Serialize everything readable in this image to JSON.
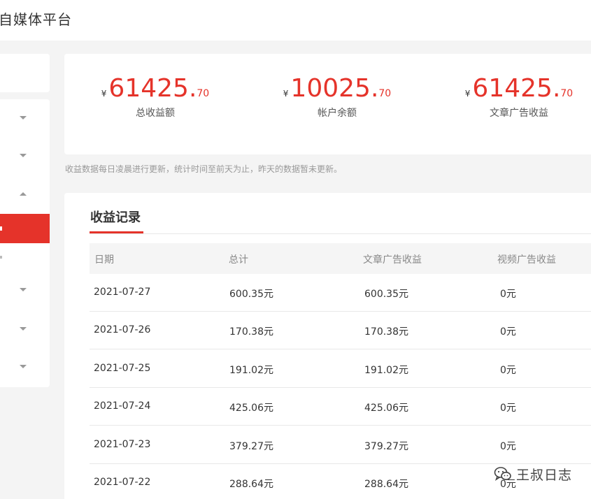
{
  "header": {
    "app_title": "自媒体平台"
  },
  "stats": [
    {
      "currency": "¥",
      "integer": "61425.",
      "decimal": "70",
      "label": "总收益额"
    },
    {
      "currency": "¥",
      "integer": "10025.",
      "decimal": "70",
      "label": "帐户余额"
    },
    {
      "currency": "¥",
      "integer": "61425.",
      "decimal": "70",
      "label": "文章广告收益"
    }
  ],
  "note": "收益数据每日凌晨进行更新，统计时间至前天为止，昨天的数据暂未更新。",
  "records": {
    "title": "收益记录",
    "columns": [
      "日期",
      "总计",
      "文章广告收益",
      "视频广告收益"
    ],
    "rows": [
      [
        "2021-07-27",
        "600.35元",
        "600.35元",
        "0元"
      ],
      [
        "2021-07-26",
        "170.38元",
        "170.38元",
        "0元"
      ],
      [
        "2021-07-25",
        "191.02元",
        "191.02元",
        "0元"
      ],
      [
        "2021-07-24",
        "425.06元",
        "425.06元",
        "0元"
      ],
      [
        "2021-07-23",
        "379.27元",
        "379.27元",
        "0元"
      ],
      [
        "2021-07-22",
        "288.64元",
        "288.64元",
        "0元"
      ]
    ]
  },
  "sidebar": {
    "carets": [
      "chevron-down-icon",
      "chevron-down-icon",
      "chevron-up-icon",
      "chevron-down-icon",
      "chevron-down-icon",
      "chevron-down-icon"
    ]
  },
  "watermark": {
    "text": "王叔日志",
    "logo": "wechat-icon"
  },
  "colors": {
    "accent": "#e5332a",
    "background": "#f4f4f4",
    "card": "#ffffff"
  }
}
